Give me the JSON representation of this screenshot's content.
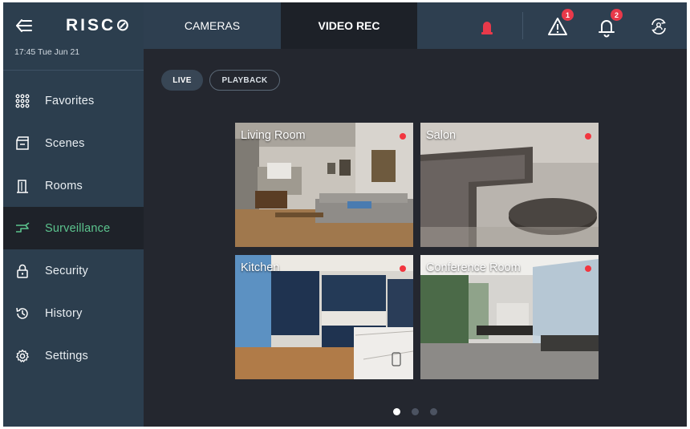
{
  "app": {
    "logo": "RISC⊘",
    "datetime": "17:45 Tue Jun 21"
  },
  "sidebar": {
    "items": [
      {
        "label": "Favorites",
        "icon": "grid-icon"
      },
      {
        "label": "Scenes",
        "icon": "scenes-icon"
      },
      {
        "label": "Rooms",
        "icon": "door-icon"
      },
      {
        "label": "Surveillance",
        "icon": "camera-icon",
        "active": true
      },
      {
        "label": "Security",
        "icon": "lock-icon"
      },
      {
        "label": "History",
        "icon": "history-icon"
      },
      {
        "label": "Settings",
        "icon": "gear-icon"
      }
    ]
  },
  "topbar": {
    "tabs": [
      {
        "label": "CAMERAS"
      },
      {
        "label": "VIDEO REC",
        "active": true
      }
    ],
    "alert_badge": "1",
    "notification_badge": "2"
  },
  "mode": {
    "live_label": "LIVE",
    "playback_label": "PLAYBACK",
    "selected": "LIVE"
  },
  "cameras": [
    {
      "name": "Living Room",
      "recording": true
    },
    {
      "name": "Salon",
      "recording": true
    },
    {
      "name": "Kitchen",
      "recording": true
    },
    {
      "name": "Conference Room",
      "recording": true
    }
  ],
  "pager": {
    "pages": 3,
    "current": 1
  },
  "colors": {
    "accent": "#5cc48e",
    "rec": "#f2363f",
    "badge": "#e8394a",
    "siren": "#e8394a"
  }
}
